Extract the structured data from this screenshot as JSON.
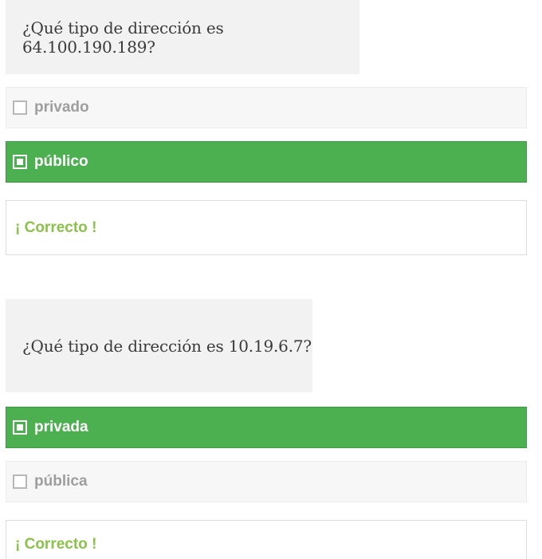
{
  "colors": {
    "selected_bg": "#4caf50",
    "unselected_bg": "#f7f7f7",
    "question_bg": "#f2f2f2",
    "feedback_text": "#8bc34a"
  },
  "questions": [
    {
      "text": "¿Qué tipo de dirección es 64.100.190.189?",
      "options": [
        {
          "label": "privado",
          "selected": false
        },
        {
          "label": "público",
          "selected": true
        }
      ],
      "feedback": "¡ Correcto !"
    },
    {
      "text": "¿Qué tipo de dirección es 10.19.6.7?",
      "options": [
        {
          "label": "privada",
          "selected": true
        },
        {
          "label": "pública",
          "selected": false
        }
      ],
      "feedback": "¡ Correcto !"
    }
  ]
}
